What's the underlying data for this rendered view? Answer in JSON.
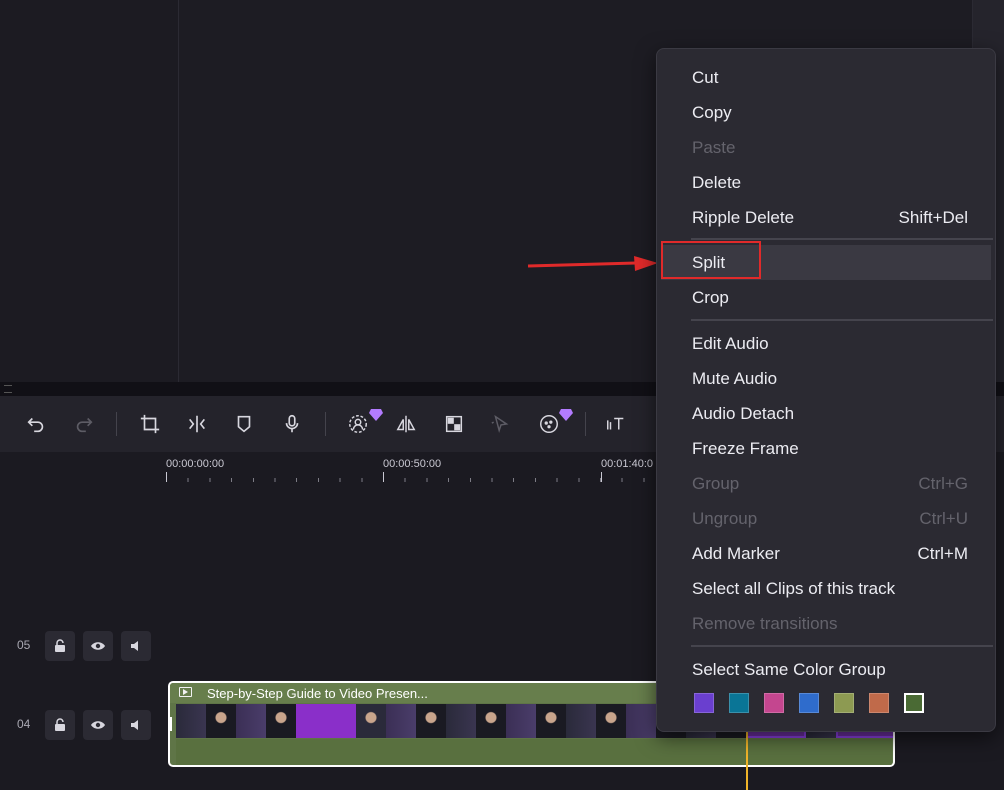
{
  "timeline": {
    "timecodes": [
      "00:00:00:00",
      "00:00:50:00",
      "00:01:40:0"
    ],
    "tracks": [
      {
        "number": "05"
      },
      {
        "number": "04"
      }
    ],
    "clip": {
      "title": "Step-by-Step Guide to Video Presen..."
    }
  },
  "toolbar": {
    "icons": [
      "undo-icon",
      "redo-icon",
      "crop-icon",
      "split-icon",
      "marker-icon",
      "microphone-icon",
      "ai-portrait-icon",
      "mirror-icon",
      "mosaic-icon",
      "motion-tracking-icon",
      "ai-effect-icon",
      "text-speed-icon"
    ]
  },
  "context_menu": {
    "items": [
      {
        "label": "Cut",
        "shortcut": "",
        "enabled": true
      },
      {
        "label": "Copy",
        "shortcut": "",
        "enabled": true
      },
      {
        "label": "Paste",
        "shortcut": "",
        "enabled": false
      },
      {
        "label": "Delete",
        "shortcut": "",
        "enabled": true
      },
      {
        "label": "Ripple Delete",
        "shortcut": "Shift+Del",
        "enabled": true
      },
      {
        "label": "Split",
        "shortcut": "",
        "enabled": true,
        "highlighted": true
      },
      {
        "label": "Crop",
        "shortcut": "",
        "enabled": true
      },
      {
        "label": "Edit Audio",
        "shortcut": "",
        "enabled": true
      },
      {
        "label": "Mute Audio",
        "shortcut": "",
        "enabled": true
      },
      {
        "label": "Audio Detach",
        "shortcut": "",
        "enabled": true
      },
      {
        "label": "Freeze Frame",
        "shortcut": "",
        "enabled": true
      },
      {
        "label": "Group",
        "shortcut": "Ctrl+G",
        "enabled": false
      },
      {
        "label": "Ungroup",
        "shortcut": "Ctrl+U",
        "enabled": false
      },
      {
        "label": "Add Marker",
        "shortcut": "Ctrl+M",
        "enabled": true
      },
      {
        "label": "Select all Clips of this track",
        "shortcut": "",
        "enabled": true
      },
      {
        "label": "Remove transitions",
        "shortcut": "",
        "enabled": false
      },
      {
        "label": "Select Same Color Group",
        "shortcut": "",
        "enabled": true
      }
    ],
    "color_swatches": [
      "#6a3fcf",
      "#0a7596",
      "#c4468f",
      "#2f6ccc",
      "#8d9a52",
      "#c06a4a",
      "#4a6a34"
    ],
    "selected_swatch": "#4a6a34"
  },
  "colors": {
    "accent_playhead": "#f0b429",
    "annotation_red": "#e02a2a",
    "clip_green": "#5f7547"
  }
}
